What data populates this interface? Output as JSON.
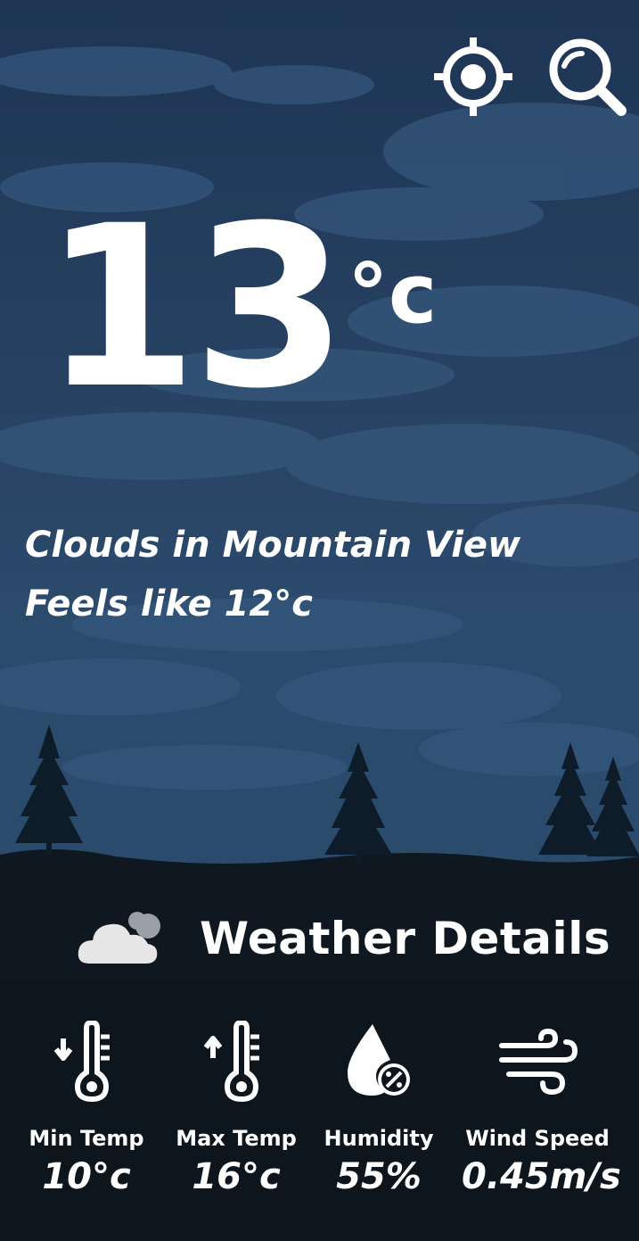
{
  "current": {
    "temperature": "13",
    "unit": "°c",
    "description": "Clouds in Mountain View",
    "feels_like": "Feels like 12°c"
  },
  "toolbar": {
    "location_icon": "crosshair-icon",
    "search_icon": "search-icon"
  },
  "details": {
    "title": "Weather Details",
    "icon": "cloud-icon",
    "items": [
      {
        "label": "Min Temp",
        "value": "10°c",
        "icon": "thermometer-down-icon"
      },
      {
        "label": "Max Temp",
        "value": "16°c",
        "icon": "thermometer-up-icon"
      },
      {
        "label": "Humidity",
        "value": "55%",
        "icon": "humidity-icon"
      },
      {
        "label": "Wind Speed",
        "value": "0.45m/s",
        "icon": "wind-icon"
      }
    ]
  },
  "colors": {
    "sky_top": "#1f3656",
    "sky_bottom": "#2c4a6c",
    "cloud": "#34557a",
    "trees": "#0d1a26",
    "ground": "#0f1820",
    "text": "#ffffff"
  }
}
